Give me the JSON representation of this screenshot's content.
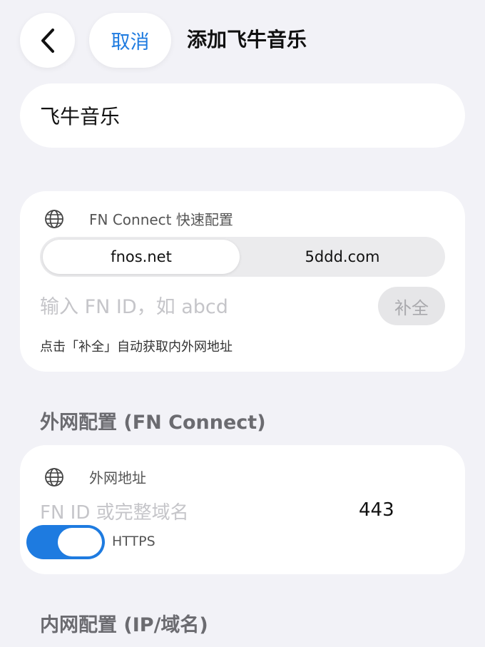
{
  "header": {
    "back_icon": "chevron-left-icon",
    "cancel_label": "取消",
    "title": "添加飞牛音乐"
  },
  "name_field": {
    "value": "飞牛音乐"
  },
  "fn_connect": {
    "icon": "globe-icon",
    "label": "FN Connect 快速配置",
    "segments": [
      {
        "label": "fnos.net",
        "selected": true
      },
      {
        "label": "5ddd.com",
        "selected": false
      }
    ],
    "input_placeholder": "输入 FN ID，如 abcd",
    "input_value": "",
    "complete_label": "补全",
    "hint": "点击「补全」自动获取内外网地址"
  },
  "wan_section": {
    "title": "外网配置 (FN Connect)",
    "icon": "globe-icon",
    "label": "外网地址",
    "input_placeholder": "FN ID 或完整域名",
    "input_value": "",
    "port": "443",
    "https_label": "HTTPS",
    "https_enabled": true
  },
  "lan_section": {
    "title": "内网配置 (IP/域名)"
  },
  "colors": {
    "accent": "#1e7be0",
    "background": "#f2f2f7",
    "card": "#ffffff",
    "placeholder": "#c5c5c9"
  }
}
